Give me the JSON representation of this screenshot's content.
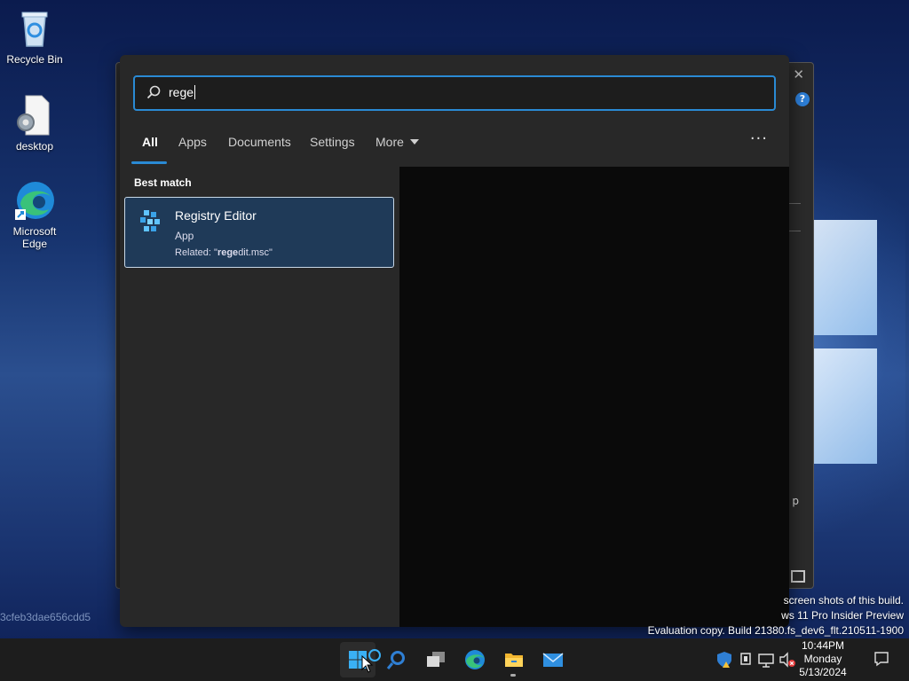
{
  "desktop": {
    "icons": [
      {
        "label": "Recycle Bin"
      },
      {
        "label": "desktop"
      },
      {
        "label": "Microsoft Edge"
      }
    ]
  },
  "search": {
    "query": "rege"
  },
  "tabs": [
    {
      "label": "All"
    },
    {
      "label": "Apps"
    },
    {
      "label": "Documents"
    },
    {
      "label": "Settings"
    },
    {
      "label": "More"
    }
  ],
  "more_options_label": "···",
  "best_match": {
    "section_label": "Best match",
    "title": "Registry Editor",
    "type": "App",
    "related_prefix": "Related: \"",
    "related_bold": "rege",
    "related_rest": "dit.msc\""
  },
  "background_window": {
    "help_label": "?",
    "partial_text": "p"
  },
  "watermark": {
    "line1": "screen shots of this build.",
    "line2": "ws 11 Pro Insider Preview",
    "line3": "Evaluation copy. Build 21380.fs_dev6_flt.210511-1900",
    "hash": "3cfeb3dae656cdd5"
  },
  "taskbar": {
    "apps": [
      "start-icon",
      "search-icon",
      "task-view-icon",
      "edge-icon",
      "file-explorer-icon",
      "mail-icon"
    ]
  },
  "clock": {
    "time": "10:44PM",
    "day": "Monday",
    "date": "5/13/2024"
  },
  "colors": {
    "accent": "#2a8ad4",
    "panel": "#282828",
    "selected_result": "#1f3a58",
    "taskbar": "#1d1d1d"
  }
}
